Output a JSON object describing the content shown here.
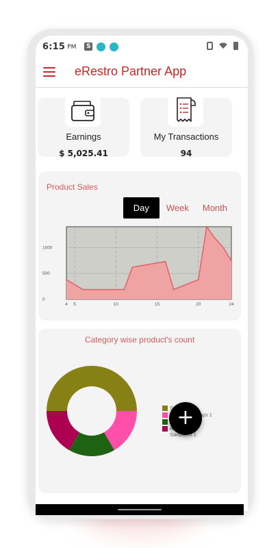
{
  "status_bar": {
    "time": "6:15",
    "ampm": "PM",
    "s_icon": "S"
  },
  "app_bar": {
    "title": "eRestro Partner App",
    "menu_icon": "hamburger-menu-icon"
  },
  "cards": {
    "earnings": {
      "label": "Earnings",
      "value": "$ 5,025.41",
      "icon": "wallet-icon"
    },
    "transactions": {
      "label": "My Transactions",
      "value": "94",
      "icon": "receipt-icon"
    }
  },
  "sales": {
    "title": "Product Sales",
    "tabs": [
      {
        "label": "Day",
        "active": true
      },
      {
        "label": "Week",
        "active": false
      },
      {
        "label": "Month",
        "active": false
      }
    ]
  },
  "category": {
    "title": "Category wise product's count"
  },
  "fab": {
    "label": "+"
  },
  "colors": {
    "accent": "#c62828",
    "line": "#e0606a",
    "area": "#f0a3a3",
    "plot_bg": "#cfcfca"
  },
  "chart_data": [
    {
      "type": "area",
      "title": "Product Sales",
      "x_ticks": [
        "4",
        "5",
        "10",
        "15",
        "20",
        "24"
      ],
      "y_ticks": [
        "0",
        "500",
        "1000"
      ],
      "ylim": [
        0,
        1400
      ],
      "xlim": [
        4,
        24
      ],
      "grid": true,
      "x": [
        4,
        6,
        11,
        12,
        16,
        17,
        20,
        21,
        22,
        23,
        24
      ],
      "y": [
        380,
        190,
        190,
        620,
        730,
        190,
        380,
        1420,
        1180,
        1000,
        740
      ]
    },
    {
      "type": "pie",
      "title": "Category wise product's count",
      "donut": true,
      "legend_position": "right",
      "series": [
        {
          "name": "Sandwich 3",
          "value": 3,
          "color": "#878014"
        },
        {
          "name": "Signature Wraps 1",
          "value": 1,
          "color": "#ff4faa"
        },
        {
          "name": "Salads 1",
          "value": 1,
          "color": "#1e6214"
        },
        {
          "name": "Breakfast Sandwich  1",
          "value": 1,
          "color": "#ad0052"
        }
      ]
    }
  ]
}
